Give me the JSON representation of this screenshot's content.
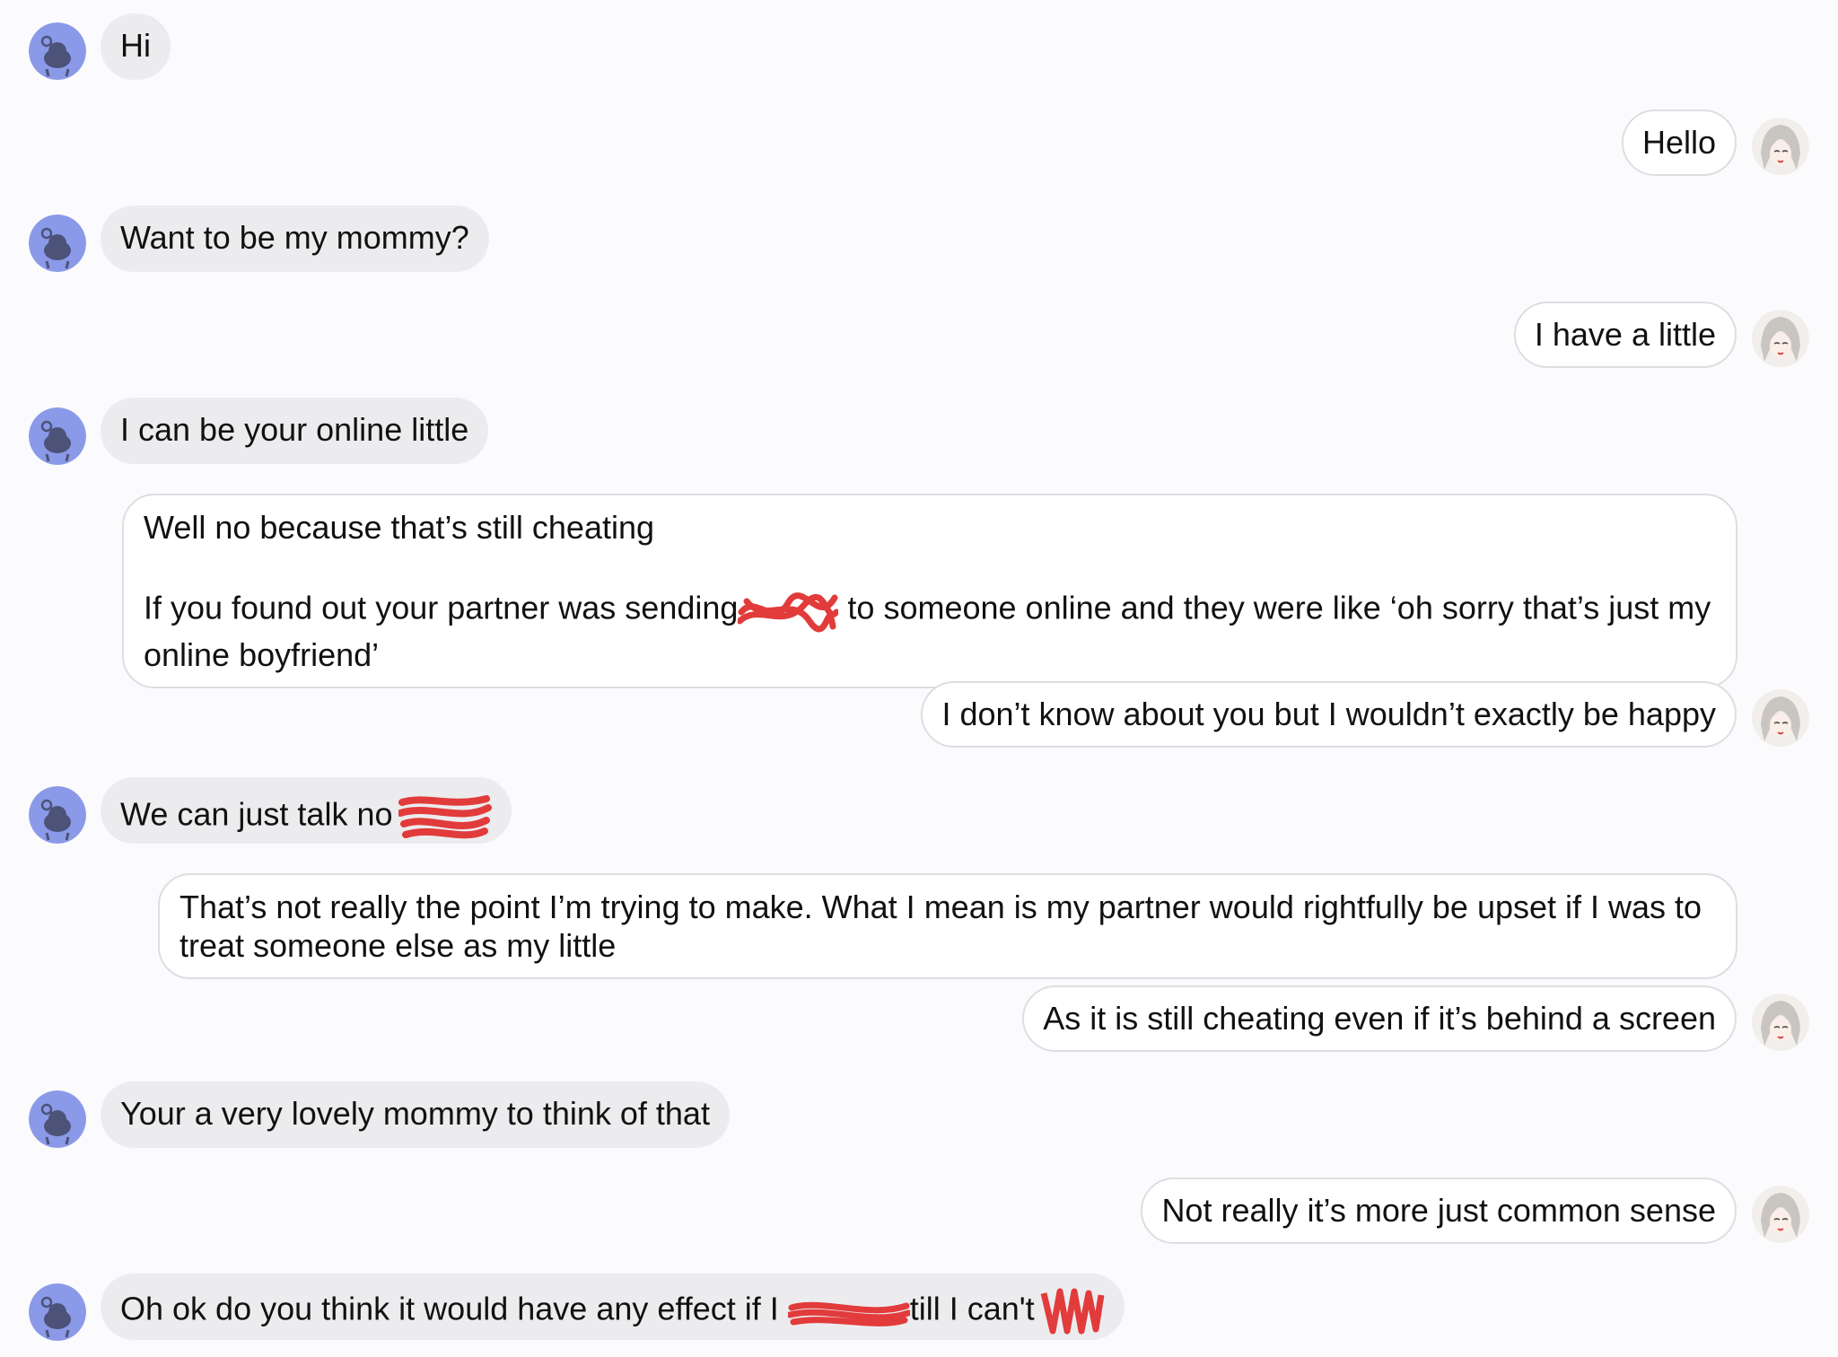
{
  "messages": [
    {
      "side": "incoming",
      "text": "Hi"
    },
    {
      "side": "outgoing",
      "text": "Hello"
    },
    {
      "side": "incoming",
      "text": "Want to be my mommy?"
    },
    {
      "side": "outgoing",
      "text": "I have a little"
    },
    {
      "side": "incoming",
      "text": "I can be your online little"
    },
    {
      "side": "outgoing",
      "line1": "Well no because that’s still cheating",
      "line2_before": "If you found out your partner was sending",
      "line2_after": " to someone online and they were like ‘oh sorry that’s just my",
      "line3": "online boyfriend’"
    },
    {
      "side": "outgoing",
      "text": "I don’t know about you but I wouldn’t exactly be happy"
    },
    {
      "side": "incoming",
      "text": "We can just talk no"
    },
    {
      "side": "outgoing",
      "line1": "That’s not really the point I’m trying to make. What I mean is my partner would rightfully be upset if I was to",
      "line2": "treat someone else as my little"
    },
    {
      "side": "outgoing",
      "text": "As it is still cheating even if it’s behind a screen"
    },
    {
      "side": "incoming",
      "text": "Your a very lovely mommy to think of that"
    },
    {
      "side": "outgoing",
      "text": "Not really it’s more just common sense"
    },
    {
      "side": "incoming",
      "text_before": "Oh ok do you think it would have any effect if I ",
      "text_mid": "till I can't"
    }
  ],
  "icons": {
    "incoming_avatar": "reddit-snoo-avatar-icon",
    "outgoing_avatar": "anime-girl-avatar-icon",
    "redaction": "red-scribble-redaction"
  },
  "colors": {
    "background": "#fbfbfd",
    "incoming_bubble": "#ececee",
    "outgoing_bubble": "#ffffff",
    "outgoing_border": "#dedee2",
    "avatar_blue": "#8a9ae8",
    "redaction_red": "#e23b3b"
  }
}
